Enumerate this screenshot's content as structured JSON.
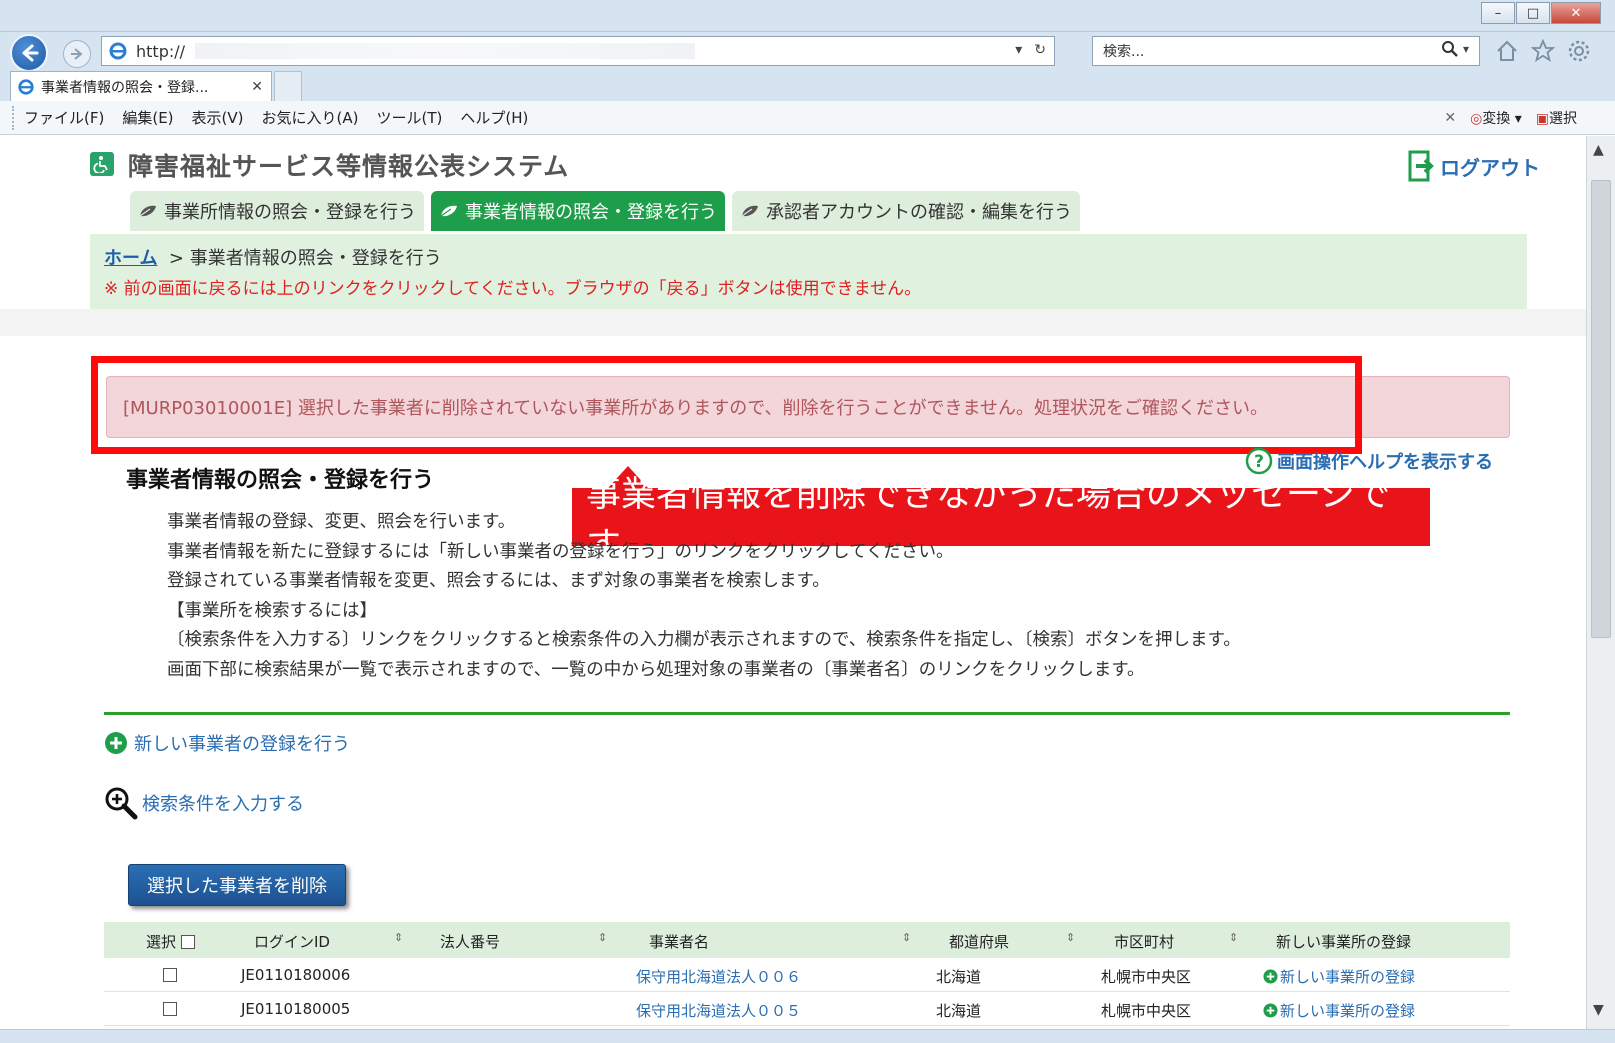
{
  "browser": {
    "url": "http://",
    "search_placeholder": "検索...",
    "tab_title": "事業者情報の照会・登録...",
    "menu": [
      "ファイル(F)",
      "編集(E)",
      "表示(V)",
      "お気に入り(A)",
      "ツール(T)",
      "ヘルプ(H)"
    ],
    "menu_right": {
      "convert": "変換",
      "select": "選択"
    }
  },
  "header": {
    "system_title": "障害福祉サービス等情報公表システム",
    "logout": "ログアウト"
  },
  "tabs": [
    {
      "label": "事業所情報の照会・登録を行う",
      "active": false
    },
    {
      "label": "事業者情報の照会・登録を行う",
      "active": true
    },
    {
      "label": "承認者アカウントの確認・編集を行う",
      "active": false
    }
  ],
  "breadcrumb": {
    "home": "ホーム",
    "separator": ">",
    "current": "事業者情報の照会・登録を行う",
    "note": "※ 前の画面に戻るには上のリンクをクリックしてください。ブラウザの「戻る」ボタンは使用できません。"
  },
  "error_message": "[MURP03010001E] 選択した事業者に削除されていない事業所がありますので、削除を行うことができません。処理状況をご確認ください。",
  "callout": "事業者情報を削除できなかった場合のメッセージです。",
  "help_link": "画面操作ヘルプを表示する",
  "section": {
    "title": "事業者情報の照会・登録を行う",
    "lines": [
      "事業者情報の登録、変更、照会を行います。",
      "事業者情報を新たに登録するには「新しい事業者の登録を行う」のリンクをクリックしてください。",
      "登録されている事業者情報を変更、照会するには、まず対象の事業者を検索します。",
      "【事業所を検索するには】",
      "〔検索条件を入力する〕リンクをクリックすると検索条件の入力欄が表示されますので、検索条件を指定し、〔検索〕ボタンを押します。",
      "画面下部に検索結果が一覧で表示されますので、一覧の中から処理対象の事業者の〔事業者名〕のリンクをクリックします。"
    ]
  },
  "actions": {
    "new_operator": "新しい事業者の登録を行う",
    "search_conditions": "検索条件を入力する",
    "delete_selected": "選択した事業者を削除"
  },
  "table": {
    "headers": {
      "select": "選択",
      "login_id": "ログインID",
      "corp_no": "法人番号",
      "name": "事業者名",
      "prefecture": "都道府県",
      "city": "市区町村",
      "new_office": "新しい事業所の登録"
    },
    "sort_glyph": "⇕",
    "rows": [
      {
        "login_id": "JE0110180006",
        "corp_no": "",
        "name": "保守用北海道法人００６",
        "prefecture": "北海道",
        "city": "札幌市中央区",
        "new_office": "新しい事業所の登録"
      },
      {
        "login_id": "JE0110180005",
        "corp_no": "",
        "name": "保守用北海道法人００５",
        "prefecture": "北海道",
        "city": "札幌市中央区",
        "new_office": "新しい事業所の登録"
      }
    ]
  },
  "colors": {
    "accent_green": "#1e9e4a",
    "error_bg": "#f2d6d9",
    "callout_red": "#e8141a",
    "link_blue": "#2a6db0"
  }
}
